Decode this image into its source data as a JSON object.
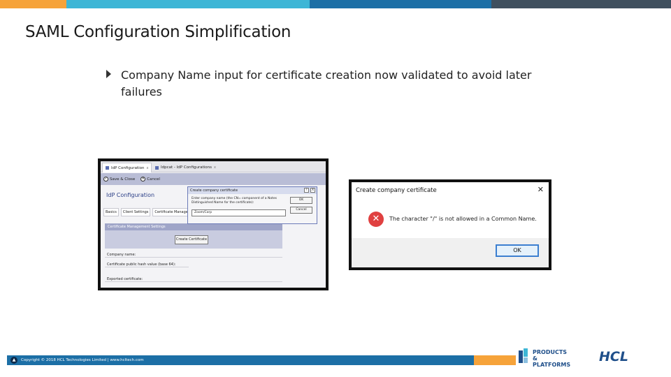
{
  "slide": {
    "title": "SAML Configuration Simplification",
    "bullet": "Company Name input for certificate creation now validated to avoid later failures"
  },
  "colors": {
    "top_bar": [
      "#f6a33a",
      "#3db6d6",
      "#1c6fa6",
      "#3f4f5e"
    ],
    "footer_bar": "#1c6fa6",
    "footer_accent": "#f6a33a",
    "error_icon": "#e04040"
  },
  "idp_screenshot": {
    "tabs": [
      {
        "label": "IdP Configuration",
        "close": "x"
      },
      {
        "label": "Idpcat - IdP Configurations",
        "close": "x"
      }
    ],
    "toolbar": {
      "save_close_label": "Save & Close",
      "cancel_label": "Cancel"
    },
    "heading": "IdP Configuration",
    "subtabs": [
      "Basics",
      "Client Settings",
      "Certificate Management"
    ],
    "section_title": "Certificate Management Settings",
    "create_button": "Create Certificate",
    "fields": [
      {
        "label": "Company name:"
      },
      {
        "label": "Certificate public hash value (base 64):"
      },
      {
        "label": "Exported certificate:"
      }
    ],
    "dialog": {
      "title": "Create company certificate",
      "help": "?",
      "close": "X",
      "text": "Enter company name (the CN= component of a Notes Distinguished Name for the certificate):",
      "input_value": "Zoom/Corp",
      "ok_label": "OK",
      "cancel_label": "Cancel"
    }
  },
  "error_dialog": {
    "title": "Create company certificate",
    "close": "✕",
    "icon": "error-icon",
    "message": "The character \"/\" is not allowed in a Common Name.",
    "ok_label": "OK"
  },
  "footer": {
    "copyright": "Copyright © 2018 HCL Technologies Limited | www.hcltech.com",
    "products_logo_line1": "PRODUCTS",
    "products_logo_line2": "& PLATFORMS",
    "hcl_logo": "HCL"
  }
}
